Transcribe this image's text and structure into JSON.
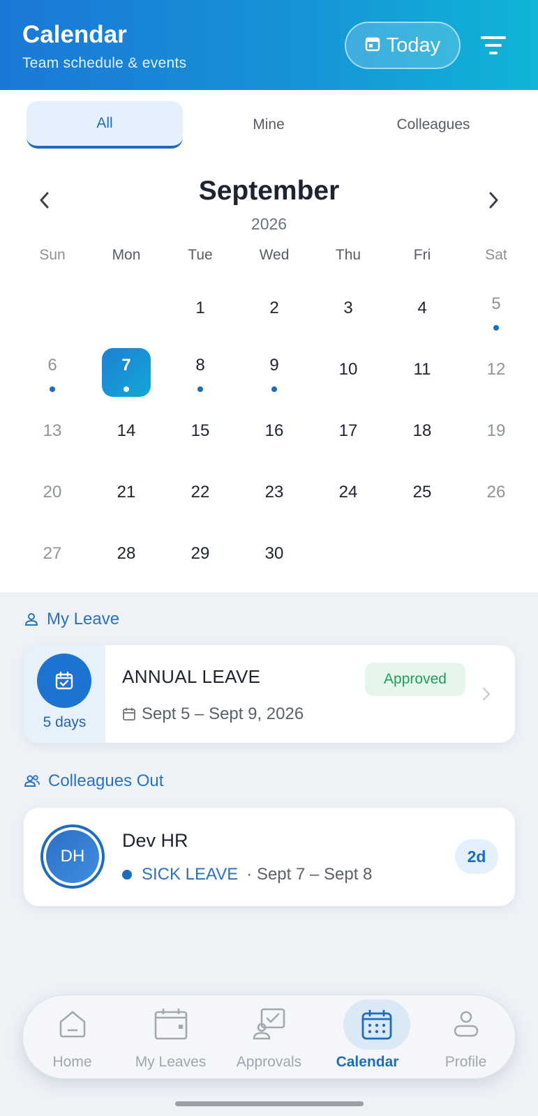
{
  "header": {
    "title": "Calendar",
    "subtitle": "Team schedule & events",
    "today_label": "Today"
  },
  "tabs": [
    {
      "label": "All",
      "active": true
    },
    {
      "label": "Mine",
      "active": false
    },
    {
      "label": "Colleagues",
      "active": false
    }
  ],
  "calendar": {
    "month": "September",
    "year": "2026",
    "weekdays": [
      "Sun",
      "Mon",
      "Tue",
      "Wed",
      "Thu",
      "Fri",
      "Sat"
    ],
    "first_weekday_index": 2,
    "days_in_month": 30,
    "selected_day": 7,
    "event_days": [
      5,
      6,
      7,
      8,
      9
    ]
  },
  "my_leave": {
    "section_label": "My Leave",
    "duration": "5 days",
    "title": "ANNUAL LEAVE",
    "dates": "Sept 5 – Sept 9, 2026",
    "status": "Approved"
  },
  "colleagues_out": {
    "section_label": "Colleagues Out",
    "items": [
      {
        "initials": "DH",
        "name": "Dev HR",
        "leave_type": "SICK LEAVE",
        "dates": "· Sept 7 – Sept 8",
        "duration": "2d"
      }
    ]
  },
  "bottom_nav": [
    {
      "label": "Home",
      "icon": "home-icon",
      "active": false
    },
    {
      "label": "My Leaves",
      "icon": "wallet-icon",
      "active": false
    },
    {
      "label": "Approvals",
      "icon": "approvals-icon",
      "active": false
    },
    {
      "label": "Calendar",
      "icon": "calendar-icon",
      "active": true
    },
    {
      "label": "Profile",
      "icon": "profile-icon",
      "active": false
    }
  ],
  "colors": {
    "accent": "#1e6cc0",
    "header_start": "#1a78d6",
    "header_end": "#0fb5d6",
    "approved": "#1f9e57"
  }
}
